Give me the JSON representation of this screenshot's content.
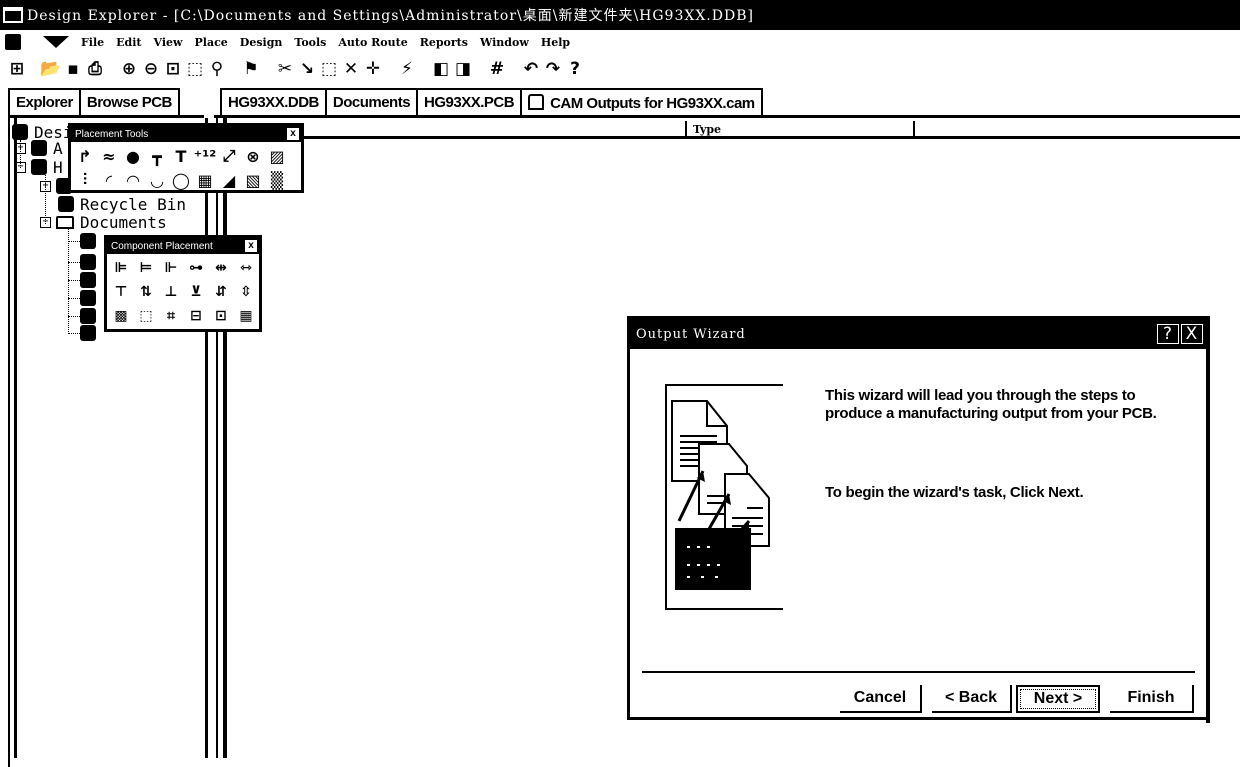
{
  "window": {
    "title": "Design Explorer - [C:\\Documents and Settings\\Administrator\\桌面\\新建文件夹\\HG93XX.DDB]"
  },
  "menubar": {
    "items": [
      "File",
      "Edit",
      "View",
      "Place",
      "Design",
      "Tools",
      "Auto Route",
      "Reports",
      "Window",
      "Help"
    ]
  },
  "toolbar": {
    "buttons": [
      {
        "name": "design-manager",
        "glyph": "⊞"
      },
      {
        "name": "open",
        "glyph": "📂"
      },
      {
        "name": "save",
        "glyph": "▪"
      },
      {
        "name": "print",
        "glyph": "⎙"
      },
      {
        "name": "zoom-in",
        "glyph": "⊕"
      },
      {
        "name": "zoom-out",
        "glyph": "⊖"
      },
      {
        "name": "zoom-fit",
        "glyph": "⊡"
      },
      {
        "name": "zoom-area",
        "glyph": "⬚"
      },
      {
        "name": "zoom-last",
        "glyph": "⚲"
      },
      {
        "name": "cross-probe",
        "glyph": "⚑"
      },
      {
        "name": "cut",
        "glyph": "✂"
      },
      {
        "name": "interactive-route",
        "glyph": "↘"
      },
      {
        "name": "select",
        "glyph": "⬚"
      },
      {
        "name": "deselect",
        "glyph": "✕"
      },
      {
        "name": "move",
        "glyph": "✛"
      },
      {
        "name": "pick",
        "glyph": "⚡"
      },
      {
        "name": "browse-lib",
        "glyph": "◧"
      },
      {
        "name": "place-lib",
        "glyph": "◨"
      },
      {
        "name": "grid",
        "glyph": "#"
      },
      {
        "name": "undo",
        "glyph": "↶"
      },
      {
        "name": "redo",
        "glyph": "↷"
      },
      {
        "name": "help",
        "glyph": "?"
      }
    ]
  },
  "left_tabs": [
    "Explorer",
    "Browse PCB"
  ],
  "doc_tabs": [
    "HG93XX.DDB",
    "Documents",
    "HG93XX.PCB",
    "CAM Outputs for HG93XX.cam"
  ],
  "tree": {
    "root": "Desi",
    "node_a": "A",
    "node_h": "H",
    "recycle_bin": "Recycle Bin",
    "documents": "Documents"
  },
  "grid": {
    "columns": [
      "",
      "Type",
      ""
    ]
  },
  "placement_tools": {
    "title": "Placement Tools",
    "close": "x",
    "tools": [
      "track",
      "line",
      "pad",
      "via",
      "text",
      "coordinate",
      "dimension",
      "keepout",
      "fill",
      "component",
      "arc-center",
      "arc-edge",
      "arc-any",
      "circle",
      "polygon",
      "split-plane",
      "string",
      "array"
    ],
    "glyphs": [
      "↱",
      "≈",
      "●",
      "┳",
      "T",
      "⁺¹²",
      "⤢",
      "⊗",
      "▨",
      "⫶",
      "◜",
      "◠",
      "◡",
      "◯",
      "▦",
      "◢",
      "▧",
      "▒"
    ]
  },
  "component_placement": {
    "title": "Component Placement",
    "close": "x",
    "glyphs": [
      "⊫",
      "⊨",
      "⊩",
      "⊶",
      "⇹",
      "⇿",
      "⊤",
      "⇅",
      "⊥",
      "⊻",
      "⇵",
      "⇳",
      "▩",
      "⬚",
      "⌗",
      "⊟",
      "⊡",
      "▦"
    ]
  },
  "dialog": {
    "title": "Output Wizard",
    "help": "?",
    "close": "X",
    "text1": "This wizard will lead you through the steps to produce a manufacturing output from your PCB.",
    "text2": "To begin the wizard's task, Click Next.",
    "buttons": {
      "cancel": "Cancel",
      "back": "< Back",
      "next": "Next >",
      "finish": "Finish"
    }
  }
}
